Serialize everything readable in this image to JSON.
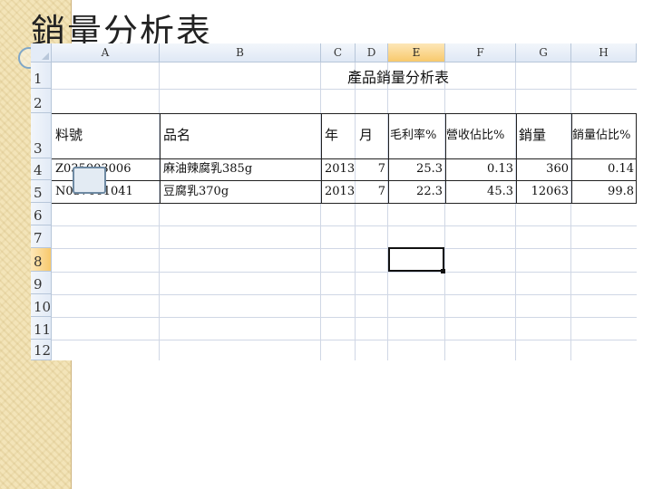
{
  "slide": {
    "title": "銷量分析表"
  },
  "spreadsheet": {
    "corner_icon": "select-all-triangle",
    "columns": [
      "A",
      "B",
      "C",
      "D",
      "E",
      "F",
      "G",
      "H"
    ],
    "active_column": "E",
    "rows": [
      "1",
      "2",
      "3",
      "4",
      "5",
      "6",
      "7",
      "8",
      "9",
      "10",
      "11",
      "12"
    ],
    "active_row": "8",
    "sheet_title": "產品銷量分析表",
    "headers": {
      "item_no": "料號",
      "product_name": "品名",
      "year": "年",
      "month": "月",
      "gross_margin": "毛利率%",
      "revenue_share": "營收佔比%",
      "sales": "銷量",
      "sales_share": "銷量佔比%"
    },
    "data_rows": [
      {
        "item_no": "Z035003006",
        "product_name": "麻油辣腐乳385g",
        "year": "2013",
        "month": "7",
        "gross_margin": "25.3",
        "revenue_share": "0.13",
        "sales": "360",
        "sales_share": "0.14"
      },
      {
        "item_no": "N037001041",
        "product_name": "豆腐乳370g",
        "year": "2013",
        "month": "7",
        "gross_margin": "22.3",
        "revenue_share": "45.3",
        "sales": "12063",
        "sales_share": "99.8"
      }
    ],
    "selected_cell": "E8"
  },
  "colors": {
    "active_header": "#f8c96c",
    "header_bg": "#dfe8f5",
    "gridline": "#d0d7e5",
    "side_strip": "#f3e4b8"
  }
}
